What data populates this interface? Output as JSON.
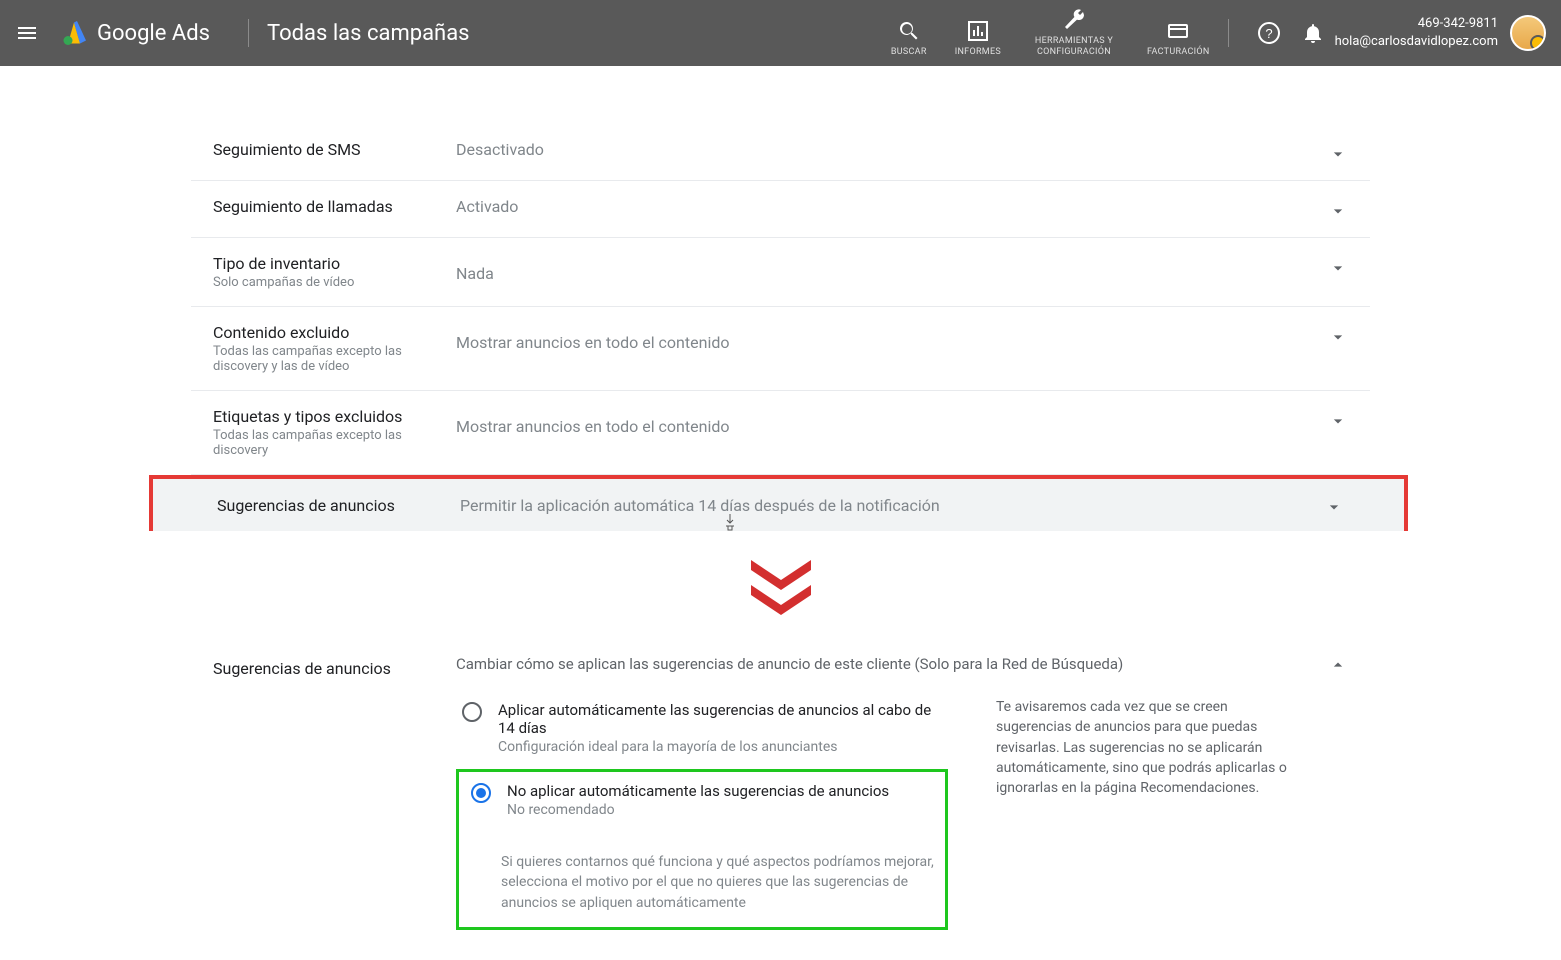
{
  "header": {
    "brand": "Google Ads",
    "title": "Todas las campañas",
    "tools": {
      "search": "BUSCAR",
      "reports": "INFORMES",
      "tools_config": "HERRAMIENTAS Y CONFIGURACIÓN",
      "billing": "FACTURACIÓN"
    },
    "account_phone": "469-342-9811",
    "account_email": "hola@carlosdavidlopez.com"
  },
  "settings": [
    {
      "label": "Seguimiento de SMS",
      "sub": "",
      "value": "Desactivado"
    },
    {
      "label": "Seguimiento de llamadas",
      "sub": "",
      "value": "Activado"
    },
    {
      "label": "Tipo de inventario",
      "sub": "Solo campañas de vídeo",
      "value": "Nada"
    },
    {
      "label": "Contenido excluido",
      "sub": "Todas las campañas excepto las discovery y las de vídeo",
      "value": "Mostrar anuncios en todo el contenido"
    },
    {
      "label": "Etiquetas y tipos excluidos",
      "sub": "Todas las campañas excepto las discovery",
      "value": "Mostrar anuncios en todo el contenido"
    },
    {
      "label": "Sugerencias de anuncios",
      "sub": "",
      "value": "Permitir la aplicación automática 14 días después de la notificación"
    }
  ],
  "expanded": {
    "label": "Sugerencias de anuncios",
    "desc": "Cambiar cómo se aplican las sugerencias de anuncio de este cliente (Solo para la Red de Búsqueda)",
    "option1_title": "Aplicar automáticamente las sugerencias de anuncios al cabo de 14 días",
    "option1_sub": "Configuración ideal para la mayoría de los anunciantes",
    "option2_title": "No aplicar automáticamente las sugerencias de anuncios",
    "option2_sub": "No recomendado",
    "option2_note": "Si quieres contarnos qué funciona y qué aspectos podríamos mejorar, selecciona el motivo por el que no quieres que las sugerencias de anuncios se apliquen automáticamente",
    "side_note": "Te avisaremos cada vez que se creen sugerencias de anuncios para que puedas revisarlas. Las sugerencias no se aplicarán automáticamente, sino que podrás aplicarlas o ignorarlas en la página Recomendaciones."
  }
}
